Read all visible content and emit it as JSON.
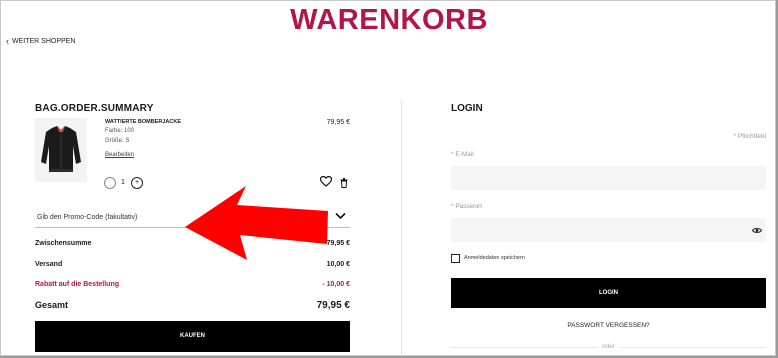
{
  "header": {
    "title": "WARENKORB",
    "back_label": "WEITER SHOPPEN"
  },
  "summary": {
    "title": "BAG.ORDER.SUMMARY",
    "product": {
      "name": "WATTIERTE BOMBERJACKE",
      "price": "79,95 €",
      "color": "Farbe: 100",
      "size": "Größe: S",
      "edit_label": "Bearbeiten",
      "quantity": "1"
    },
    "promo_label": "Gib den Promo-Code (fakultativ)",
    "rows": {
      "subtotal": {
        "label": "Zwischensumme",
        "value": "79,95 €"
      },
      "shipping": {
        "label": "Versand",
        "value": "10,00 €"
      },
      "discount": {
        "label": "Rabatt auf die Bestellung",
        "value": "- 10,00 €"
      },
      "total": {
        "label": "Gesamt",
        "value": "79,95 €"
      }
    },
    "buy_label": "KAUFEN"
  },
  "login": {
    "title": "LOGIN",
    "required_note": "* Pflichtfeld",
    "email_label": "* E-Mail",
    "email_value": "",
    "password_label": "* Passwort",
    "password_value": "",
    "remember_label": "Anmeldedaten speichern",
    "login_label": "LOGIN",
    "forgot_label": "PASSWORT VERGESSEN?",
    "or_label": "oder"
  },
  "colors": {
    "brand": "#b0164b",
    "button": "#000000",
    "arrow": "#ff0000"
  },
  "icons": [
    "chevron-left-icon",
    "heart-icon",
    "trash-icon",
    "chevron-down-icon",
    "eye-icon",
    "plus-icon",
    "red-arrow-annotation"
  ]
}
